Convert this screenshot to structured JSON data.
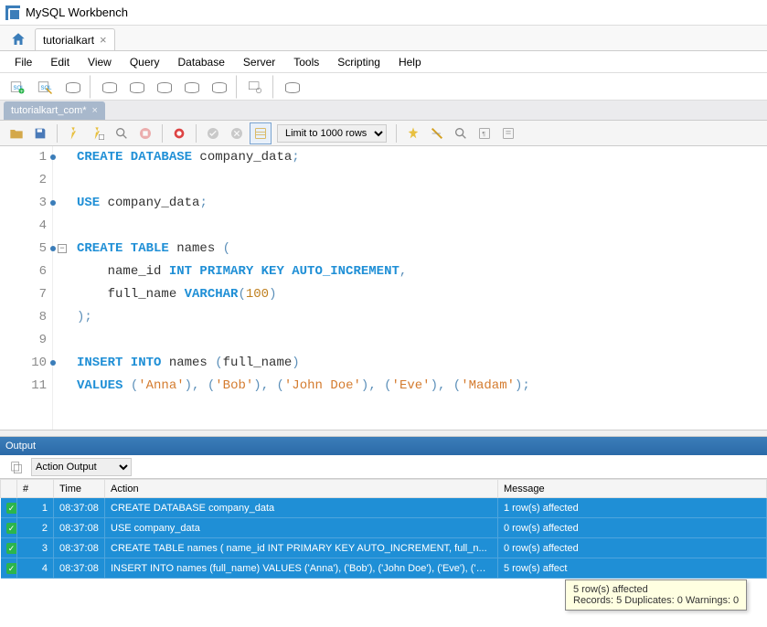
{
  "window": {
    "title": "MySQL Workbench"
  },
  "connection_tab": {
    "label": "tutorialkart"
  },
  "menu": [
    "File",
    "Edit",
    "View",
    "Query",
    "Database",
    "Server",
    "Tools",
    "Scripting",
    "Help"
  ],
  "sql_tab": {
    "label": "tutorialkart_com*"
  },
  "limit_rows": "Limit to 1000 rows",
  "editor": {
    "lines": [
      {
        "n": 1,
        "exec": true,
        "tokens": [
          {
            "t": "CREATE DATABASE",
            "c": "kw"
          },
          {
            "t": " company_data",
            "c": "id"
          },
          {
            "t": ";",
            "c": "pn"
          }
        ]
      },
      {
        "n": 2,
        "exec": false,
        "tokens": []
      },
      {
        "n": 3,
        "exec": true,
        "tokens": [
          {
            "t": "USE",
            "c": "kw"
          },
          {
            "t": " company_data",
            "c": "id"
          },
          {
            "t": ";",
            "c": "pn"
          }
        ]
      },
      {
        "n": 4,
        "exec": false,
        "tokens": []
      },
      {
        "n": 5,
        "exec": true,
        "fold": true,
        "tokens": [
          {
            "t": "CREATE TABLE",
            "c": "kw"
          },
          {
            "t": " names ",
            "c": "id"
          },
          {
            "t": "(",
            "c": "pn"
          }
        ]
      },
      {
        "n": 6,
        "exec": false,
        "indent": 4,
        "tokens": [
          {
            "t": "name_id ",
            "c": "id"
          },
          {
            "t": "INT PRIMARY KEY AUTO_INCREMENT",
            "c": "ty"
          },
          {
            "t": ",",
            "c": "pn"
          }
        ]
      },
      {
        "n": 7,
        "exec": false,
        "indent": 4,
        "tokens": [
          {
            "t": "full_name ",
            "c": "id"
          },
          {
            "t": "VARCHAR",
            "c": "ty"
          },
          {
            "t": "(",
            "c": "pn"
          },
          {
            "t": "100",
            "c": "num"
          },
          {
            "t": ")",
            "c": "pn"
          }
        ]
      },
      {
        "n": 8,
        "exec": false,
        "tokens": [
          {
            "t": ");",
            "c": "pn"
          }
        ]
      },
      {
        "n": 9,
        "exec": false,
        "tokens": []
      },
      {
        "n": 10,
        "exec": true,
        "tokens": [
          {
            "t": "INSERT INTO",
            "c": "kw"
          },
          {
            "t": " names ",
            "c": "id"
          },
          {
            "t": "(",
            "c": "pn"
          },
          {
            "t": "full_name",
            "c": "id"
          },
          {
            "t": ")",
            "c": "pn"
          }
        ]
      },
      {
        "n": 11,
        "exec": false,
        "tokens": [
          {
            "t": "VALUES ",
            "c": "kw"
          },
          {
            "t": "(",
            "c": "pn"
          },
          {
            "t": "'Anna'",
            "c": "str"
          },
          {
            "t": ")",
            "c": "pn"
          },
          {
            "t": ", ",
            "c": "pn"
          },
          {
            "t": "(",
            "c": "pn"
          },
          {
            "t": "'Bob'",
            "c": "str"
          },
          {
            "t": ")",
            "c": "pn"
          },
          {
            "t": ", ",
            "c": "pn"
          },
          {
            "t": "(",
            "c": "pn"
          },
          {
            "t": "'John Doe'",
            "c": "str"
          },
          {
            "t": ")",
            "c": "pn"
          },
          {
            "t": ", ",
            "c": "pn"
          },
          {
            "t": "(",
            "c": "pn"
          },
          {
            "t": "'Eve'",
            "c": "str"
          },
          {
            "t": ")",
            "c": "pn"
          },
          {
            "t": ", ",
            "c": "pn"
          },
          {
            "t": "(",
            "c": "pn"
          },
          {
            "t": "'Madam'",
            "c": "str"
          },
          {
            "t": ")",
            "c": "pn"
          },
          {
            "t": ";",
            "c": "pn"
          }
        ]
      }
    ]
  },
  "output": {
    "title": "Output",
    "selector": "Action Output",
    "cols": [
      "",
      "#",
      "Time",
      "Action",
      "Message"
    ],
    "rows": [
      {
        "i": "1",
        "t": "08:37:08",
        "a": "CREATE DATABASE company_data",
        "m": "1 row(s) affected"
      },
      {
        "i": "2",
        "t": "08:37:08",
        "a": "USE company_data",
        "m": "0 row(s) affected"
      },
      {
        "i": "3",
        "t": "08:37:08",
        "a": "CREATE TABLE names (     name_id INT PRIMARY KEY AUTO_INCREMENT,     full_n...",
        "m": "0 row(s) affected"
      },
      {
        "i": "4",
        "t": "08:37:08",
        "a": "INSERT INTO names (full_name) VALUES ('Anna'), ('Bob'), ('John Doe'), ('Eve'), ('Madam')",
        "m": "5 row(s) affect"
      }
    ]
  },
  "tooltip": {
    "line1": "5 row(s) affected",
    "line2": "Records: 5  Duplicates: 0  Warnings: 0"
  }
}
